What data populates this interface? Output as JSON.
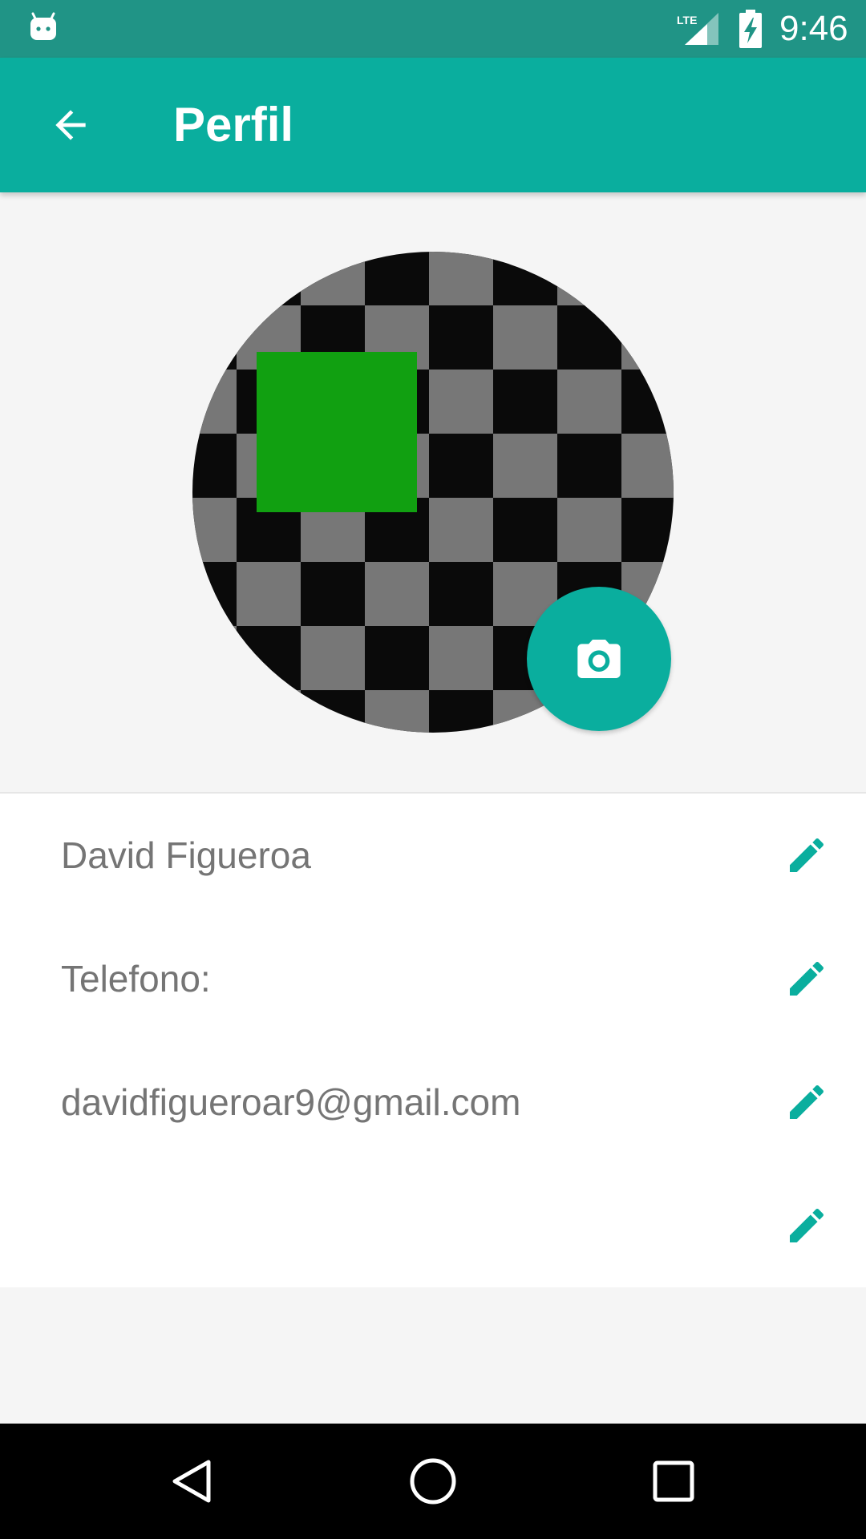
{
  "status_bar": {
    "time": "9:46",
    "network_label": "LTE",
    "icons": [
      "android-debug-icon",
      "lte-signal-icon",
      "battery-charging-icon"
    ]
  },
  "app_bar": {
    "title": "Perfil",
    "back_icon": "arrow-back-icon"
  },
  "profile": {
    "camera_icon": "camera-icon",
    "fields": [
      {
        "value": "David Figueroa",
        "edit_icon": "pencil-icon"
      },
      {
        "value": "Telefono:",
        "edit_icon": "pencil-icon"
      },
      {
        "value": "davidfigueroar9@gmail.com",
        "edit_icon": "pencil-icon"
      },
      {
        "value": "",
        "edit_icon": "pencil-icon"
      }
    ]
  },
  "nav_bar": {
    "icons": [
      "back-triangle-icon",
      "home-circle-icon",
      "recents-square-icon"
    ]
  },
  "colors": {
    "status_bar": "#209486",
    "primary": "#0aae9e",
    "background": "#f5f5f5",
    "text_secondary": "#757575",
    "avatar_dark": "#0a0a0a",
    "avatar_light": "#777777",
    "avatar_green": "#11a011"
  }
}
